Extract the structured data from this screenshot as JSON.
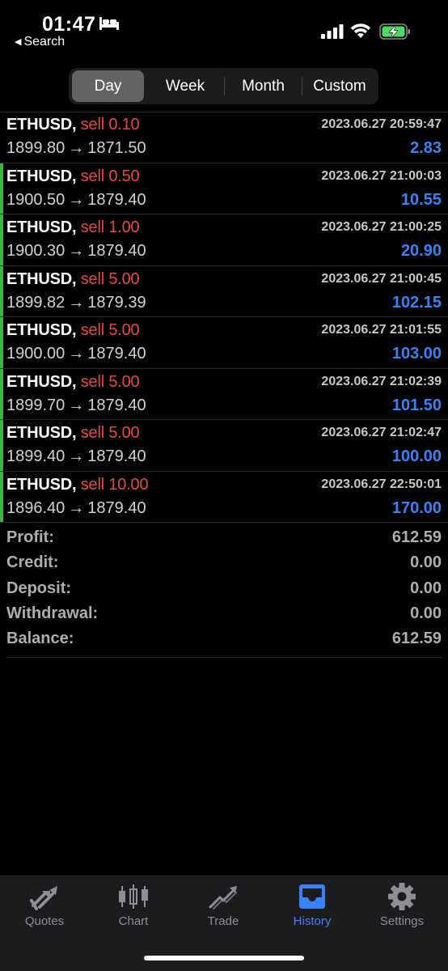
{
  "status_bar": {
    "time": "01:47",
    "back_label": "Search",
    "icons": [
      "bed-icon",
      "signal-icon",
      "wifi-icon",
      "battery-charging-icon"
    ],
    "battery_color": "#4cd964"
  },
  "period_tabs": {
    "selected": "Day",
    "items": [
      {
        "label": "Day"
      },
      {
        "label": "Week"
      },
      {
        "label": "Month"
      },
      {
        "label": "Custom"
      }
    ]
  },
  "deals": [
    {
      "symbol": "ETHUSD,",
      "side": "sell",
      "volume": "0.10",
      "datetime": "2023.06.27 20:59:47",
      "open_price": "1899.80",
      "close_price": "1871.50",
      "profit": "2.83",
      "marked": false
    },
    {
      "symbol": "ETHUSD,",
      "side": "sell",
      "volume": "0.50",
      "datetime": "2023.06.27 21:00:03",
      "open_price": "1900.50",
      "close_price": "1879.40",
      "profit": "10.55",
      "marked": true
    },
    {
      "symbol": "ETHUSD,",
      "side": "sell",
      "volume": "1.00",
      "datetime": "2023.06.27 21:00:25",
      "open_price": "1900.30",
      "close_price": "1879.40",
      "profit": "20.90",
      "marked": true
    },
    {
      "symbol": "ETHUSD,",
      "side": "sell",
      "volume": "5.00",
      "datetime": "2023.06.27 21:00:45",
      "open_price": "1899.82",
      "close_price": "1879.39",
      "profit": "102.15",
      "marked": true
    },
    {
      "symbol": "ETHUSD,",
      "side": "sell",
      "volume": "5.00",
      "datetime": "2023.06.27 21:01:55",
      "open_price": "1900.00",
      "close_price": "1879.40",
      "profit": "103.00",
      "marked": true
    },
    {
      "symbol": "ETHUSD,",
      "side": "sell",
      "volume": "5.00",
      "datetime": "2023.06.27 21:02:39",
      "open_price": "1899.70",
      "close_price": "1879.40",
      "profit": "101.50",
      "marked": true
    },
    {
      "symbol": "ETHUSD,",
      "side": "sell",
      "volume": "5.00",
      "datetime": "2023.06.27 21:02:47",
      "open_price": "1899.40",
      "close_price": "1879.40",
      "profit": "100.00",
      "marked": true
    },
    {
      "symbol": "ETHUSD,",
      "side": "sell",
      "volume": "10.00",
      "datetime": "2023.06.27 22:50:01",
      "open_price": "1896.40",
      "close_price": "1879.40",
      "profit": "170.00",
      "marked": true
    }
  ],
  "arrow_glyph": "→",
  "summary": [
    {
      "label": "Profit:",
      "value": "612.59"
    },
    {
      "label": "Credit:",
      "value": "0.00"
    },
    {
      "label": "Deposit:",
      "value": "0.00"
    },
    {
      "label": "Withdrawal:",
      "value": "0.00"
    },
    {
      "label": "Balance:",
      "value": "612.59"
    }
  ],
  "colors": {
    "sell": "#e5493d",
    "profit": "#3a82f7",
    "active_tab": "#3a82f7",
    "inactive_tab": "#8e8e93",
    "row_marker": "#3fb24a"
  },
  "tab_bar": {
    "selected": "History",
    "items": [
      {
        "label": "Quotes",
        "icon": "quotes-arrows-icon"
      },
      {
        "label": "Chart",
        "icon": "candlestick-chart-icon"
      },
      {
        "label": "Trade",
        "icon": "trade-trend-icon"
      },
      {
        "label": "History",
        "icon": "history-inbox-icon"
      },
      {
        "label": "Settings",
        "icon": "gear-icon"
      }
    ]
  }
}
